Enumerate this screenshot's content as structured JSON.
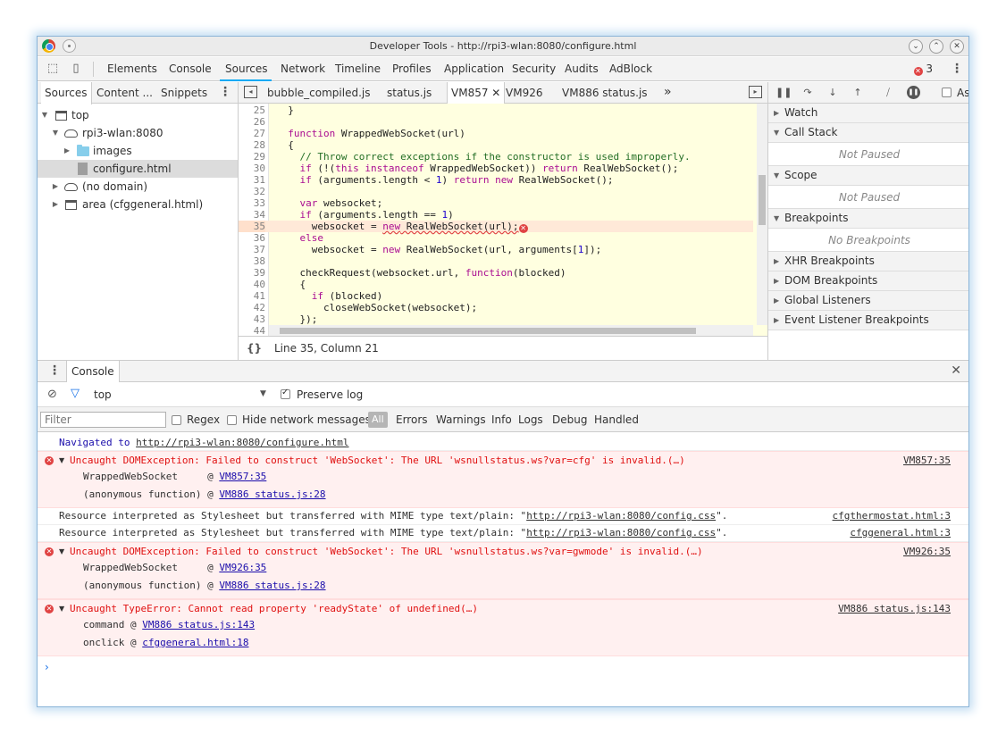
{
  "window": {
    "title": "Developer Tools - http://rpi3-wlan:8080/configure.html",
    "title_buttons": [
      "chevron-down",
      "chevron-up",
      "close"
    ]
  },
  "toolbar": {
    "tabs": [
      "Elements",
      "Console",
      "Sources",
      "Network",
      "Timeline",
      "Profiles",
      "Application",
      "Security",
      "Audits",
      "AdBlock"
    ],
    "active_tab": "Sources",
    "error_count": "3"
  },
  "navigator": {
    "tabs": [
      "Sources",
      "Content ...",
      "Snippets"
    ],
    "active_tab": "Sources",
    "tree": [
      {
        "label": "top",
        "icon": "frame-icon",
        "expanded": true,
        "depth": 0
      },
      {
        "label": "rpi3-wlan:8080",
        "icon": "cloud-icon",
        "expanded": true,
        "depth": 1
      },
      {
        "label": "images",
        "icon": "folder-icon",
        "expanded": false,
        "depth": 2
      },
      {
        "label": "configure.html",
        "icon": "file-icon",
        "selected": true,
        "depth": 2
      },
      {
        "label": "(no domain)",
        "icon": "cloud-icon",
        "expanded": false,
        "depth": 1
      },
      {
        "label": "area (cfggeneral.html)",
        "icon": "frame-icon",
        "expanded": false,
        "depth": 1
      }
    ]
  },
  "editor": {
    "tabs": [
      "bubble_compiled.js",
      "status.js",
      "VM857",
      "VM926",
      "VM886 status.js"
    ],
    "active_tab": "VM857",
    "more_tabs": "»",
    "lines": [
      {
        "n": "25",
        "t": "  }"
      },
      {
        "n": "26",
        "t": ""
      },
      {
        "n": "27",
        "t": "  function WrappedWebSocket(url)"
      },
      {
        "n": "28",
        "t": "  {"
      },
      {
        "n": "29",
        "t": "    // Throw correct exceptions if the constructor is used improperly."
      },
      {
        "n": "30",
        "t": "    if (!(this instanceof WrappedWebSocket)) return RealWebSocket();"
      },
      {
        "n": "31",
        "t": "    if (arguments.length < 1) return new RealWebSocket();"
      },
      {
        "n": "32",
        "t": ""
      },
      {
        "n": "33",
        "t": "    var websocket;"
      },
      {
        "n": "34",
        "t": "    if (arguments.length == 1)"
      },
      {
        "n": "35",
        "t": "      websocket = new RealWebSocket(url);"
      },
      {
        "n": "36",
        "t": "    else"
      },
      {
        "n": "37",
        "t": "      websocket = new RealWebSocket(url, arguments[1]);"
      },
      {
        "n": "38",
        "t": ""
      },
      {
        "n": "39",
        "t": "    checkRequest(websocket.url, function(blocked)"
      },
      {
        "n": "40",
        "t": "    {"
      },
      {
        "n": "41",
        "t": "      if (blocked)"
      },
      {
        "n": "42",
        "t": "        closeWebSocket(websocket);"
      },
      {
        "n": "43",
        "t": "    });"
      },
      {
        "n": "44",
        "t": ""
      }
    ],
    "highlight_line": "35",
    "status": "Line 35, Column 21",
    "status_icon": "{}"
  },
  "debugger": {
    "sections": [
      {
        "title": "Watch",
        "expanded": false,
        "body": ""
      },
      {
        "title": "Call Stack",
        "expanded": true,
        "body": "Not Paused"
      },
      {
        "title": "Scope",
        "expanded": true,
        "body": "Not Paused"
      },
      {
        "title": "Breakpoints",
        "expanded": true,
        "body": "No Breakpoints"
      },
      {
        "title": "XHR Breakpoints",
        "expanded": false,
        "body": ""
      },
      {
        "title": "DOM Breakpoints",
        "expanded": false,
        "body": ""
      },
      {
        "title": "Global Listeners",
        "expanded": false,
        "body": ""
      },
      {
        "title": "Event Listener Breakpoints",
        "expanded": false,
        "body": ""
      }
    ],
    "async_label": "As"
  },
  "console": {
    "tab": "Console",
    "context": "top",
    "preserve_log": "Preserve log",
    "filter_placeholder": "Filter",
    "regex": "Regex",
    "hide_network": "Hide network messages",
    "levels": [
      "All",
      "Errors",
      "Warnings",
      "Info",
      "Logs",
      "Debug",
      "Handled"
    ],
    "navigated_prefix": "Navigated to ",
    "navigated_url": "http://rpi3-wlan:8080/configure.html",
    "messages": [
      {
        "text": "Uncaught DOMException: Failed to construct 'WebSocket': The URL 'wsnullstatus.ws?var=cfg' is invalid.(…)",
        "source": "VM857:35",
        "stack": [
          {
            "fn": "WrappedWebSocket     @ ",
            "loc": "VM857:35"
          },
          {
            "fn": "(anonymous function) @ ",
            "loc": "VM886 status.js:28"
          }
        ]
      },
      {
        "text": "Uncaught DOMException: Failed to construct 'WebSocket': The URL 'wsnullstatus.ws?var=gwmode' is invalid.(…)",
        "source": "VM926:35",
        "stack": [
          {
            "fn": "WrappedWebSocket     @ ",
            "loc": "VM926:35"
          },
          {
            "fn": "(anonymous function) @ ",
            "loc": "VM886 status.js:28"
          }
        ]
      },
      {
        "text": "Uncaught TypeError: Cannot read property 'readyState' of undefined(…)",
        "source": "VM886 status.js:143",
        "stack": [
          {
            "fn": "command @ ",
            "loc": "VM886 status.js:143"
          },
          {
            "fn": "onclick @ ",
            "loc": "cfggeneral.html:18"
          }
        ]
      }
    ],
    "resources": [
      {
        "prefix": "Resource interpreted as Stylesheet but transferred with MIME type text/plain: \"",
        "url": "http://rpi3-wlan:8080/config.css",
        "suffix": "\".",
        "source": "cfgthermostat.html:3"
      },
      {
        "prefix": "Resource interpreted as Stylesheet but transferred with MIME type text/plain: \"",
        "url": "http://rpi3-wlan:8080/config.css",
        "suffix": "\".",
        "source": "cfggeneral.html:3"
      }
    ],
    "prompt": "›"
  },
  "colors": {
    "accent": "#03a9f4",
    "error": "#e04343",
    "error_bg": "#fff0f0",
    "code_bg": "#ffffe0",
    "link": "#1a0dab"
  }
}
